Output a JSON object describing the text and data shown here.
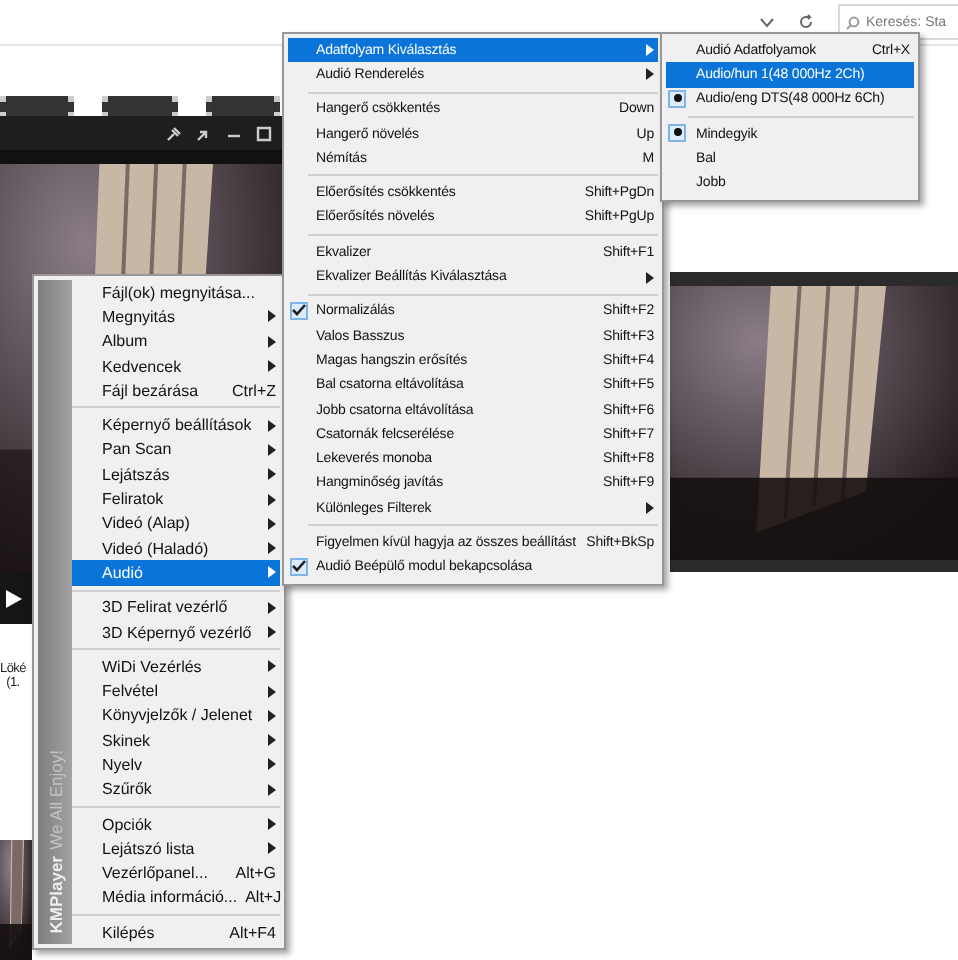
{
  "search": {
    "placeholder": "Keresés: Sta"
  },
  "player_caption": [
    "Löké",
    "(1."
  ],
  "main_menu": {
    "logo": "KMPlayer",
    "tagline": "We All Enjoy!",
    "items": [
      {
        "kind": "item",
        "label": "Fájl(ok) megnyitása...",
        "submenu": false,
        "selected": false
      },
      {
        "kind": "item",
        "label": "Megnyitás",
        "submenu": true,
        "selected": false
      },
      {
        "kind": "item",
        "label": "Album",
        "submenu": true,
        "selected": false
      },
      {
        "kind": "item",
        "label": "Kedvencek",
        "submenu": true,
        "selected": false
      },
      {
        "kind": "item",
        "label": "Fájl bezárása",
        "shortcut": "Ctrl+Z",
        "submenu": false,
        "selected": false
      },
      {
        "kind": "separator"
      },
      {
        "kind": "item",
        "label": "Képernyő beállítások",
        "submenu": true,
        "selected": false
      },
      {
        "kind": "item",
        "label": "Pan  Scan",
        "submenu": true,
        "selected": false
      },
      {
        "kind": "item",
        "label": "Lejátszás",
        "submenu": true,
        "selected": false
      },
      {
        "kind": "item",
        "label": "Feliratok",
        "submenu": true,
        "selected": false
      },
      {
        "kind": "item",
        "label": "Videó (Alap)",
        "submenu": true,
        "selected": false
      },
      {
        "kind": "item",
        "label": "Videó (Haladó)",
        "submenu": true,
        "selected": false
      },
      {
        "kind": "item",
        "label": "Audió",
        "submenu": true,
        "selected": true
      },
      {
        "kind": "separator"
      },
      {
        "kind": "item",
        "label": "3D Felirat vezérlő",
        "submenu": true,
        "selected": false
      },
      {
        "kind": "item",
        "label": "3D Képernyő vezérlő",
        "submenu": true,
        "selected": false
      },
      {
        "kind": "separator"
      },
      {
        "kind": "item",
        "label": "WiDi Vezérlés",
        "submenu": true,
        "selected": false
      },
      {
        "kind": "item",
        "label": "Felvétel",
        "submenu": true,
        "selected": false
      },
      {
        "kind": "item",
        "label": "Könyvjelzők / Jelenet",
        "submenu": true,
        "selected": false
      },
      {
        "kind": "item",
        "label": "Skinek",
        "submenu": true,
        "selected": false
      },
      {
        "kind": "item",
        "label": "Nyelv",
        "submenu": true,
        "selected": false
      },
      {
        "kind": "item",
        "label": "Szűrők",
        "submenu": true,
        "selected": false
      },
      {
        "kind": "separator"
      },
      {
        "kind": "item",
        "label": "Opciók",
        "submenu": true,
        "selected": false
      },
      {
        "kind": "item",
        "label": "Lejátszó lista",
        "submenu": true,
        "selected": false
      },
      {
        "kind": "item",
        "label": "Vezérlőpanel...",
        "shortcut": "Alt+G",
        "submenu": false,
        "selected": false
      },
      {
        "kind": "item",
        "label": "Média információ...",
        "shortcut": "Alt+J",
        "submenu": false,
        "selected": false
      },
      {
        "kind": "separator"
      },
      {
        "kind": "item",
        "label": "Kilépés",
        "shortcut": "Alt+F4",
        "submenu": false,
        "selected": false
      }
    ]
  },
  "audio_menu": {
    "items": [
      {
        "kind": "item",
        "label": "Adatfolyam Kiválasztás",
        "submenu": true,
        "checked": false,
        "selected": true
      },
      {
        "kind": "item",
        "label": "Audió Renderelés",
        "submenu": true,
        "checked": false,
        "selected": false
      },
      {
        "kind": "separator"
      },
      {
        "kind": "item",
        "label": "Hangerő csökkentés",
        "shortcut": "Down",
        "submenu": false,
        "checked": false,
        "selected": false
      },
      {
        "kind": "item",
        "label": "Hangerő növelés",
        "shortcut": "Up",
        "submenu": false,
        "checked": false,
        "selected": false
      },
      {
        "kind": "item",
        "label": "Némítás",
        "shortcut": "M",
        "submenu": false,
        "checked": false,
        "selected": false
      },
      {
        "kind": "separator"
      },
      {
        "kind": "item",
        "label": "Előerősítés csökkentés",
        "shortcut": "Shift+PgDn",
        "submenu": false,
        "checked": false,
        "selected": false
      },
      {
        "kind": "item",
        "label": "Előerősítés növelés",
        "shortcut": "Shift+PgUp",
        "submenu": false,
        "checked": false,
        "selected": false
      },
      {
        "kind": "separator"
      },
      {
        "kind": "item",
        "label": "Ekvalizer",
        "shortcut": "Shift+F1",
        "submenu": false,
        "checked": false,
        "selected": false
      },
      {
        "kind": "item",
        "label": "Ekvalizer Beállítás Kiválasztása",
        "submenu": true,
        "checked": false,
        "selected": false
      },
      {
        "kind": "separator"
      },
      {
        "kind": "item",
        "label": "Normalizálás",
        "shortcut": "Shift+F2",
        "submenu": false,
        "checked": true,
        "selected": false
      },
      {
        "kind": "item",
        "label": "Valos Basszus",
        "shortcut": "Shift+F3",
        "submenu": false,
        "checked": false,
        "selected": false
      },
      {
        "kind": "item",
        "label": "Magas hangszin erősítés",
        "shortcut": "Shift+F4",
        "submenu": false,
        "checked": false,
        "selected": false
      },
      {
        "kind": "item",
        "label": "Bal csatorna eltávolítása",
        "shortcut": "Shift+F5",
        "submenu": false,
        "checked": false,
        "selected": false
      },
      {
        "kind": "item",
        "label": "Jobb csatorna eltávolítása",
        "shortcut": "Shift+F6",
        "submenu": false,
        "checked": false,
        "selected": false
      },
      {
        "kind": "item",
        "label": "Csatornák felcserélése",
        "shortcut": "Shift+F7",
        "submenu": false,
        "checked": false,
        "selected": false
      },
      {
        "kind": "item",
        "label": "Lekeverés monoba",
        "shortcut": "Shift+F8",
        "submenu": false,
        "checked": false,
        "selected": false
      },
      {
        "kind": "item",
        "label": "Hangminőség javítás",
        "shortcut": "Shift+F9",
        "submenu": false,
        "checked": false,
        "selected": false
      },
      {
        "kind": "item",
        "label": "Különleges Filterek",
        "submenu": true,
        "checked": false,
        "selected": false
      },
      {
        "kind": "separator"
      },
      {
        "kind": "item",
        "label": "Figyelmen kívül hagyja az összes beállítást",
        "shortcut": "Shift+BkSp",
        "submenu": false,
        "checked": false,
        "selected": false
      },
      {
        "kind": "item",
        "label": "Audió Beépülő modul bekapcsolása",
        "submenu": false,
        "checked": true,
        "selected": false
      }
    ]
  },
  "stream_menu": {
    "items": [
      {
        "kind": "item",
        "label": "Audió Adatfolyamok",
        "shortcut": "Ctrl+X",
        "radio": false,
        "selected": false
      },
      {
        "kind": "item",
        "label": "Audio/hun 1(48 000Hz 2Ch)",
        "radio": false,
        "selected": true
      },
      {
        "kind": "item",
        "label": "Audio/eng DTS(48 000Hz 6Ch)",
        "radio": true,
        "selected": false
      },
      {
        "kind": "separator"
      },
      {
        "kind": "item",
        "label": "Mindegyik",
        "radio": true,
        "selected": false
      },
      {
        "kind": "item",
        "label": "Bal",
        "radio": false,
        "selected": false
      },
      {
        "kind": "item",
        "label": "Jobb",
        "radio": false,
        "selected": false
      }
    ]
  }
}
